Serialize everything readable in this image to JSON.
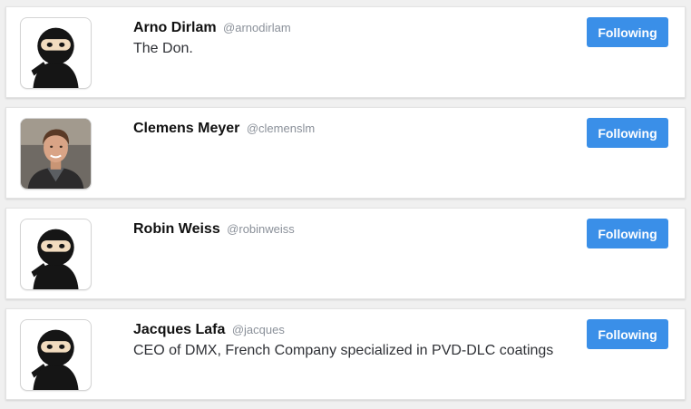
{
  "colors": {
    "page_background": "#f0f0f0",
    "card_background": "#ffffff",
    "button_background": "#3a8fe8",
    "button_text": "#ffffff",
    "name_text": "#111111",
    "handle_text": "#8a9099",
    "bio_text": "#2f3136"
  },
  "users": [
    {
      "name": "Arno Dirlam",
      "handle": "@arnodirlam",
      "bio": "The Don.",
      "avatar": "ninja-avatar-icon",
      "follow_label": "Following"
    },
    {
      "name": "Clemens Meyer",
      "handle": "@clemenslm",
      "bio": "",
      "avatar": "profile-photo",
      "follow_label": "Following"
    },
    {
      "name": "Robin Weiss",
      "handle": "@robinweiss",
      "bio": "",
      "avatar": "ninja-avatar-icon",
      "follow_label": "Following"
    },
    {
      "name": "Jacques Lafa",
      "handle": "@jacques",
      "bio": "CEO of DMX, French Company specialized in PVD-DLC coatings",
      "avatar": "ninja-avatar-icon",
      "follow_label": "Following"
    }
  ]
}
